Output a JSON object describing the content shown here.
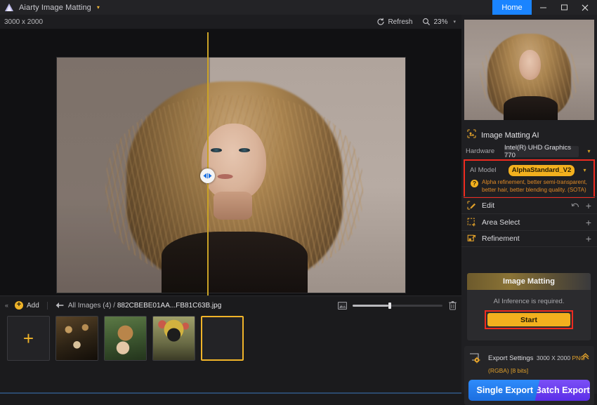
{
  "titlebar": {
    "app_title": "Aiarty Image Matting",
    "caret": "▾",
    "home_label": "Home",
    "logo": "triangle-logo"
  },
  "canvas_toolbar": {
    "dimensions": "3000 x 2000",
    "refresh_label": "Refresh",
    "zoom_value": "23%",
    "zoom_caret": "▾"
  },
  "filmstrip": {
    "collapse_caret": "«",
    "add_label": "Add",
    "add_plus": "+",
    "back_arrow": "←",
    "breadcrumb_all": "All Images (4)",
    "breadcrumb_sep": "/",
    "current_file": "882CBEBE01AA...FB81C63B.jpg",
    "thumb_add_plus": "+",
    "thumbnails": [
      {
        "name": "add-slot",
        "kind": "add"
      },
      {
        "name": "thumb-1",
        "kind": "image",
        "selected": false
      },
      {
        "name": "thumb-2",
        "kind": "image",
        "selected": false
      },
      {
        "name": "thumb-3",
        "kind": "image",
        "selected": false
      },
      {
        "name": "thumb-4",
        "kind": "image",
        "selected": true
      }
    ],
    "slider_percent": 40
  },
  "right_panel": {
    "matting_ai": {
      "section_title": "Image Matting AI",
      "hardware_label": "Hardware",
      "hardware_value": "Intel(R) UHD Graphics 770",
      "model_label": "AI Model",
      "model_value": "AlphaStandard_V2",
      "hint_mark": "?",
      "hint_text": "Alpha refinement, better semi-transparent, better hair, better blending quality. (SOTA)",
      "caret": "▾",
      "highlight_color": "#ee2b20",
      "accent_color": "#f2b01e"
    },
    "accordions": [
      {
        "label": "Edit",
        "icon": "edit-pencil-icon",
        "has_undo": true,
        "plus": "+"
      },
      {
        "label": "Area Select",
        "icon": "area-select-icon",
        "has_undo": false,
        "plus": "+"
      },
      {
        "label": "Refinement",
        "icon": "refinement-icon",
        "has_undo": false,
        "plus": "+"
      }
    ],
    "matting_card": {
      "title": "Image Matting",
      "message": "AI Inference is required.",
      "start_label": "Start",
      "highlight_color": "#ee2b20"
    },
    "export": {
      "title": "Export Settings",
      "size": "3000 X 2000",
      "format": "PNG (RGBA) [8 bits]",
      "chevron": "«",
      "single_label": "Single Export",
      "batch_label": "Batch Export",
      "single_color": "#1a84ff",
      "batch_color": "#6b3cf0"
    }
  }
}
